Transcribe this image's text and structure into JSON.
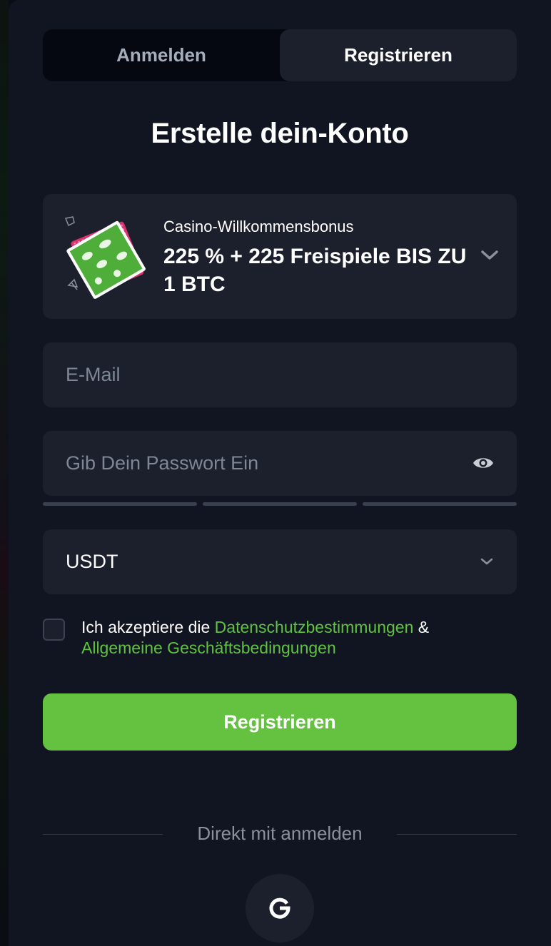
{
  "tabs": {
    "login_label": "Anmelden",
    "register_label": "Registrieren",
    "active": "Registrieren"
  },
  "title": "Erstelle dein-Konto",
  "bonus": {
    "label": "Casino-Willkommensbonus",
    "value": "225 % + 225 Freispiele BIS ZU 1 BTC",
    "icon": "chevron-down-icon"
  },
  "email": {
    "placeholder": "E-Mail",
    "value": ""
  },
  "password": {
    "placeholder": "Gib Dein Passwort Ein",
    "value": "",
    "icon": "eye-icon",
    "strength_segments": 3
  },
  "currency": {
    "selected": "USDT",
    "icon": "chevron-down-icon"
  },
  "terms": {
    "prefix": "Ich akzeptiere die",
    "privacy_link": "Datenschutzbestimmungen",
    "amp": "&",
    "tos_link": "Allgemeine Geschäftsbedingungen",
    "checked": false
  },
  "submit_label": "Registrieren",
  "social": {
    "divider_text": "Direkt mit anmelden",
    "google_icon": "google-icon"
  },
  "colors": {
    "background": "#111521",
    "field": "#1b202c",
    "accent_green": "#65c140",
    "link_green": "#5fc241",
    "muted_text": "#7f8694"
  }
}
